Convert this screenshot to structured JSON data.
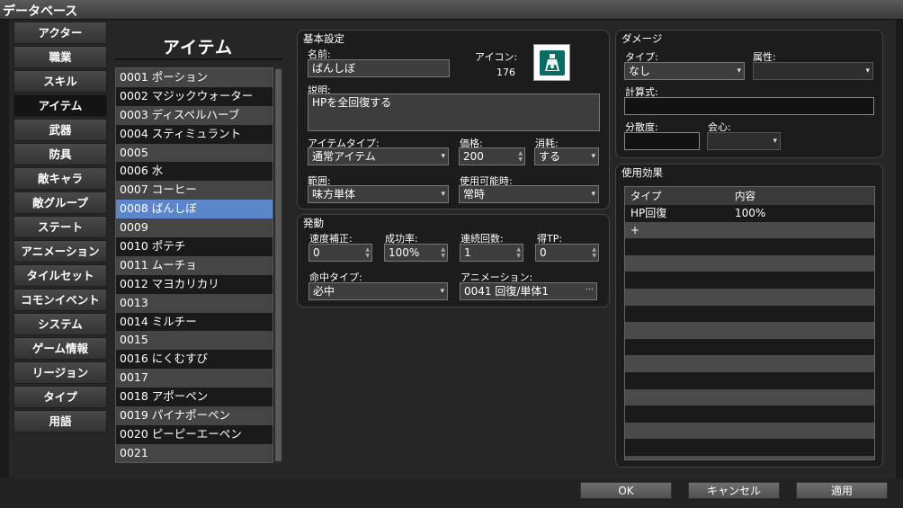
{
  "window": {
    "title": "データベース"
  },
  "categories": [
    "アクター",
    "職業",
    "スキル",
    "アイテム",
    "武器",
    "防具",
    "敵キャラ",
    "敵グループ",
    "ステート",
    "アニメーション",
    "タイルセット",
    "コモンイベント",
    "システム",
    "ゲーム情報",
    "リージョン",
    "タイプ",
    "用語"
  ],
  "active_category": "アイテム",
  "item_list": {
    "heading": "アイテム",
    "items": [
      "0001 ポーション",
      "0002 マジックウォーター",
      "0003 ディスペルハーブ",
      "0004 スティミュラント",
      "0005",
      "0006 水",
      "0007 コーヒー",
      "0008 ばんしぼ",
      "0009",
      "0010 ポテチ",
      "0011 ムーチョ",
      "0012 マヨカリカリ",
      "0013",
      "0014 ミルチー",
      "0015",
      "0016 にくむすび",
      "0017",
      "0018 アポーペン",
      "0019 パイナポーペン",
      "0020 ピーピーエーペン",
      "0021"
    ],
    "selected": "0008 ばんしぼ"
  },
  "basic": {
    "title": "基本設定",
    "name_label": "名前:",
    "name_value": "ばんしぼ",
    "icon_label": "アイコン:",
    "icon_index": "176",
    "desc_label": "説明:",
    "desc_value": "HPを全回復する",
    "item_type_label": "アイテムタイプ:",
    "item_type_value": "通常アイテム",
    "price_label": "価格:",
    "price_value": "200",
    "consume_label": "消耗:",
    "consume_value": "する",
    "scope_label": "範囲:",
    "scope_value": "味方単体",
    "occasion_label": "使用可能時:",
    "occasion_value": "常時"
  },
  "invocation": {
    "title": "発動",
    "speed_label": "速度補正:",
    "speed_value": "0",
    "success_label": "成功率:",
    "success_value": "100%",
    "repeat_label": "連続回数:",
    "repeat_value": "1",
    "tp_label": "得TP:",
    "tp_value": "0",
    "hit_type_label": "命中タイプ:",
    "hit_type_value": "必中",
    "animation_label": "アニメーション:",
    "animation_value": "0041 回復/単体1"
  },
  "damage": {
    "title": "ダメージ",
    "type_label": "タイプ:",
    "type_value": "なし",
    "element_label": "属性:",
    "element_value": "",
    "formula_label": "計算式:",
    "formula_value": "",
    "variance_label": "分散度:",
    "variance_value": "",
    "critical_label": "会心:",
    "critical_value": ""
  },
  "effects": {
    "title": "使用効果",
    "headers": [
      "タイプ",
      "内容"
    ],
    "rows": [
      [
        "HP回復",
        "100%"
      ],
      [
        "+",
        ""
      ]
    ]
  },
  "buttons": {
    "ok": "OK",
    "cancel": "キャンセル",
    "apply": "適用"
  },
  "colors": {
    "selected": "#5b86c9",
    "icon_teal": "#0c6b63"
  }
}
